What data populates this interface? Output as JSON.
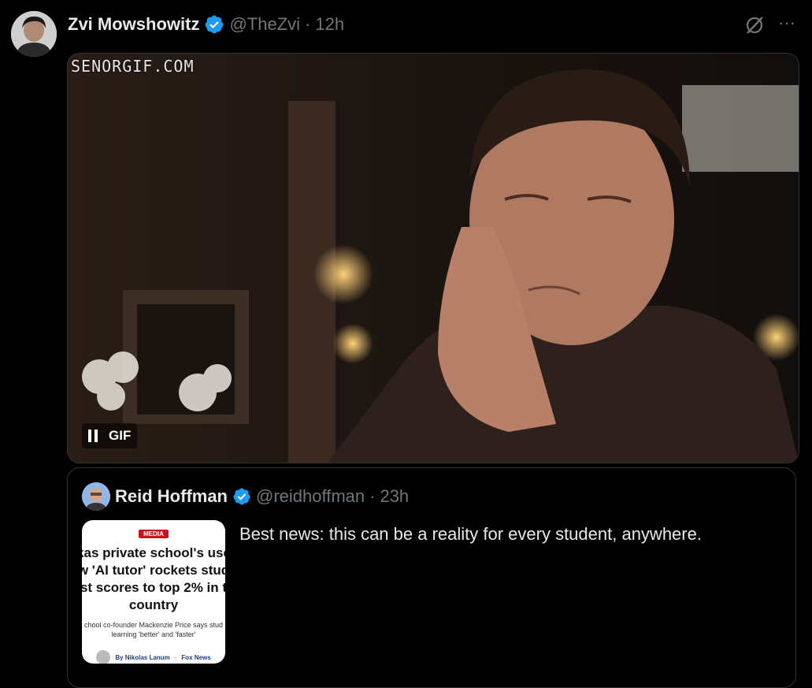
{
  "tweet": {
    "author_name": "Zvi Mowshowitz",
    "handle": "@TheZvi",
    "separator": "·",
    "time": "12h",
    "more_label": "···"
  },
  "media": {
    "watermark": "SENORGIF.COM",
    "gif_label": "GIF"
  },
  "quoted_tweet": {
    "author_name": "Reid Hoffman",
    "handle": "@reidhoffman",
    "separator": "·",
    "time": "23h",
    "text": "Best news: this can be a reality for every student, anywhere.",
    "thumbnail": {
      "badge": "MEDIA",
      "headline_lines": [
        "kas private school's use",
        "w 'AI tutor' rockets stud",
        "st scores to top 2% in t",
        "country"
      ],
      "subhead_lines": [
        "chool co-founder Mackenzie Price says stud",
        "learning 'better' and 'faster'"
      ],
      "byline_author": "By Nikolas Lanum",
      "byline_sep": "·",
      "byline_outlet": "Fox News"
    }
  },
  "colors": {
    "background": "#000000",
    "text_primary": "#e7e9ea",
    "text_secondary": "#71767b",
    "verified": "#1d9bf0",
    "border": "#2f3336"
  },
  "icons": [
    "verified-badge-icon",
    "grok-icon",
    "more-icon",
    "pause-icon"
  ]
}
